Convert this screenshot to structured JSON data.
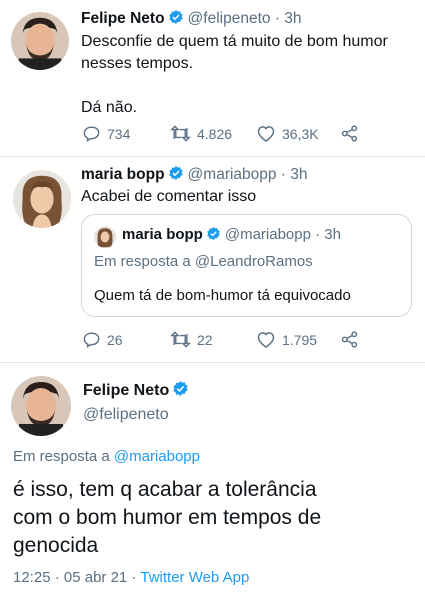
{
  "colors": {
    "verified": "#1d9bf0",
    "link": "#1d9bf0",
    "secondary": "#5b7083"
  },
  "tweet1": {
    "name": "Felipe Neto",
    "handle": "@felipeneto",
    "time": "· 3h",
    "lines": [
      "Desconfie de quem tá muito de bom humor",
      "nesses tempos.",
      "",
      "Dá não."
    ],
    "replies": "734",
    "retweets": "4.826",
    "likes": "36,3K"
  },
  "tweet2": {
    "name": "maria bopp",
    "handle": "@mariabopp",
    "time": "· 3h",
    "text": "Acabei de comentar isso",
    "quote": {
      "name": "maria bopp",
      "handle": "@mariabopp",
      "time": "· 3h",
      "reply_prefix": "Em resposta a",
      "reply_to": "@LeandroRamos",
      "text": "Quem tá de bom-humor tá equivocado"
    },
    "replies": "26",
    "retweets": "22",
    "likes": "1.795"
  },
  "tweet3": {
    "name": "Felipe Neto",
    "handle": "@felipeneto",
    "reply_prefix": "Em resposta a",
    "reply_to": "@mariabopp",
    "lines": [
      "é isso, tem q acabar a tolerância",
      "com o bom humor em tempos de",
      "genocida"
    ],
    "time": "12:25",
    "date": "05 abr 21",
    "separator": "·",
    "source": "Twitter Web App"
  },
  "icons": {
    "verified": "verified-badge-icon",
    "reply": "reply-icon",
    "retweet": "retweet-icon",
    "like": "heart-icon",
    "share": "share-icon"
  }
}
